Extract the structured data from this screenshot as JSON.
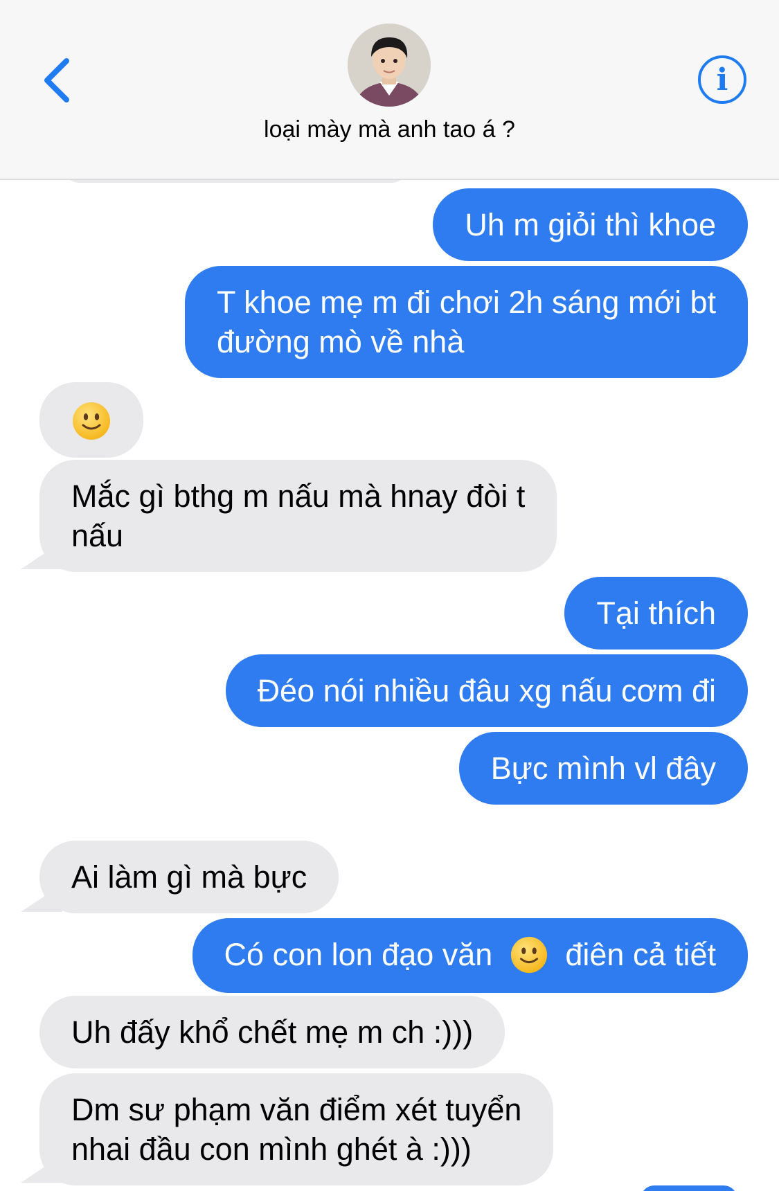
{
  "header": {
    "contact_name": "loại mày mà anh tao á ?",
    "back_icon": "chevron-left-icon",
    "info_icon": "info-icon",
    "accent_color": "#2f7cf0"
  },
  "messages": [
    {
      "side": "sent",
      "lines": [
        "Uh m giỏi thì khoe"
      ]
    },
    {
      "side": "sent",
      "lines": [
        "T khoe mẹ m đi chơi 2h sáng mới bt",
        "đường mò về nhà"
      ]
    },
    {
      "side": "received",
      "emoji": "slightly-smiling-face-icon"
    },
    {
      "side": "received",
      "lines": [
        "Mắc gì bthg m nấu mà hnay đòi t",
        "nấu"
      ]
    },
    {
      "side": "sent",
      "lines": [
        "Tại thích"
      ]
    },
    {
      "side": "sent",
      "lines": [
        "Đéo nói nhiều đâu xg nấu cơm đi"
      ]
    },
    {
      "side": "sent",
      "lines": [
        "Bực mình vl đây"
      ]
    },
    {
      "side": "received",
      "lines": [
        "Ai làm gì mà bực"
      ]
    },
    {
      "side": "sent",
      "text_before": "Có con lon đạo văn",
      "text_after": "điên cả tiết",
      "emoji": "slightly-smiling-face-icon"
    },
    {
      "side": "received",
      "lines": [
        "Uh đấy khổ chết mẹ m ch :)))"
      ]
    },
    {
      "side": "received",
      "lines": [
        "Dm sư phạm văn điểm xét tuyển",
        "nhai đầu con mình ghét à :)))"
      ]
    }
  ]
}
